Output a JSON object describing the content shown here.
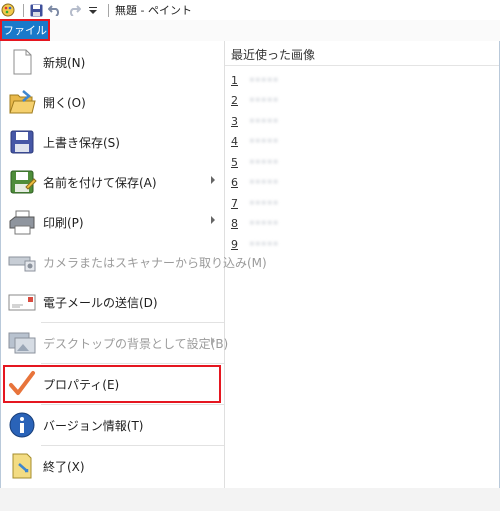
{
  "titlebar": {
    "title": "無題 - ペイント",
    "icons": [
      "paint-app-icon",
      "save-icon",
      "undo-icon",
      "redo-icon",
      "customize-dropdown-icon"
    ]
  },
  "file_tab": {
    "label": "ファイル"
  },
  "menu": {
    "items": [
      {
        "label": "新規(N)",
        "icon": "new-document-icon"
      },
      {
        "label": "開く(O)",
        "icon": "open-folder-icon"
      },
      {
        "label": "上書き保存(S)",
        "icon": "save-disk-icon"
      },
      {
        "label": "名前を付けて保存(A)",
        "icon": "save-as-icon"
      },
      {
        "label": "印刷(P)",
        "icon": "printer-icon"
      },
      {
        "label": "カメラまたはスキャナーから取り込み(M)",
        "icon": "scanner-icon"
      },
      {
        "label": "電子メールの送信(D)",
        "icon": "email-icon"
      },
      {
        "label": "デスクトップの背景として設定(B)",
        "icon": "desktop-background-icon"
      },
      {
        "label": "プロパティ(E)",
        "icon": "checkmark-icon"
      },
      {
        "label": "バージョン情報(T)",
        "icon": "info-icon"
      },
      {
        "label": "終了(X)",
        "icon": "exit-icon"
      }
    ]
  },
  "recent": {
    "heading": "最近使った画像",
    "items": [
      {
        "num": "1",
        "name": "•••••"
      },
      {
        "num": "2",
        "name": "•••••"
      },
      {
        "num": "3",
        "name": "•••••"
      },
      {
        "num": "4",
        "name": "•••••"
      },
      {
        "num": "5",
        "name": "•••••"
      },
      {
        "num": "6",
        "name": "•••••"
      },
      {
        "num": "7",
        "name": "•••••"
      },
      {
        "num": "8",
        "name": "•••••"
      },
      {
        "num": "9",
        "name": "•••••"
      }
    ]
  },
  "colors": {
    "accent": "#1979ca",
    "highlight": "#e51620"
  }
}
